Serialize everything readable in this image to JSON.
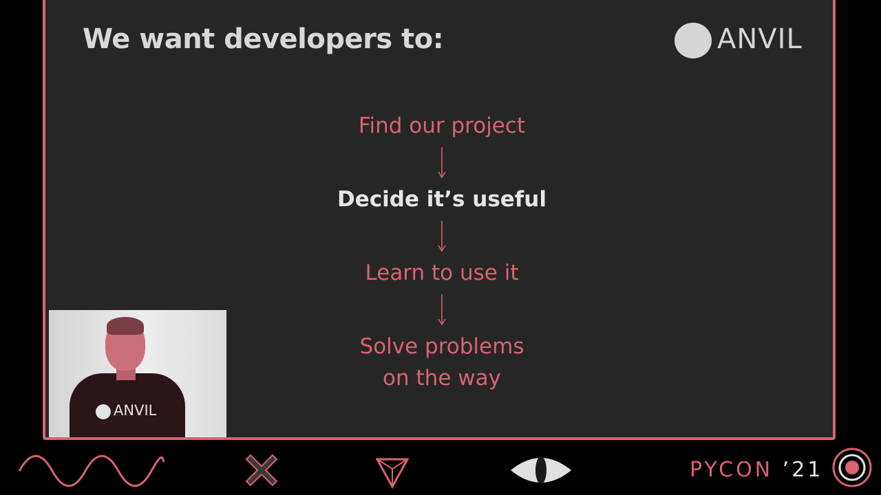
{
  "slide": {
    "title": "We want developers to:",
    "logo_text": "ANVIL"
  },
  "flow": {
    "steps": [
      {
        "label": "Find our project",
        "active": false
      },
      {
        "label": "Decide it’s useful",
        "active": true
      },
      {
        "label": "Learn to use it",
        "active": false
      },
      {
        "label": "Solve problems\non the way",
        "active": false
      }
    ]
  },
  "webcam": {
    "shirt_text": "ANVIL"
  },
  "footer": {
    "brand": "PYCON",
    "year": "’21",
    "icons": [
      "wave-icon",
      "cross-icon",
      "triangle-icon",
      "eye-icon",
      "concentric-circle-icon"
    ]
  },
  "colors": {
    "background": "#000000",
    "slide": "#262626",
    "accent": "#d9636f",
    "highlight": "#e6e6e6",
    "title": "#d8d8d8"
  }
}
